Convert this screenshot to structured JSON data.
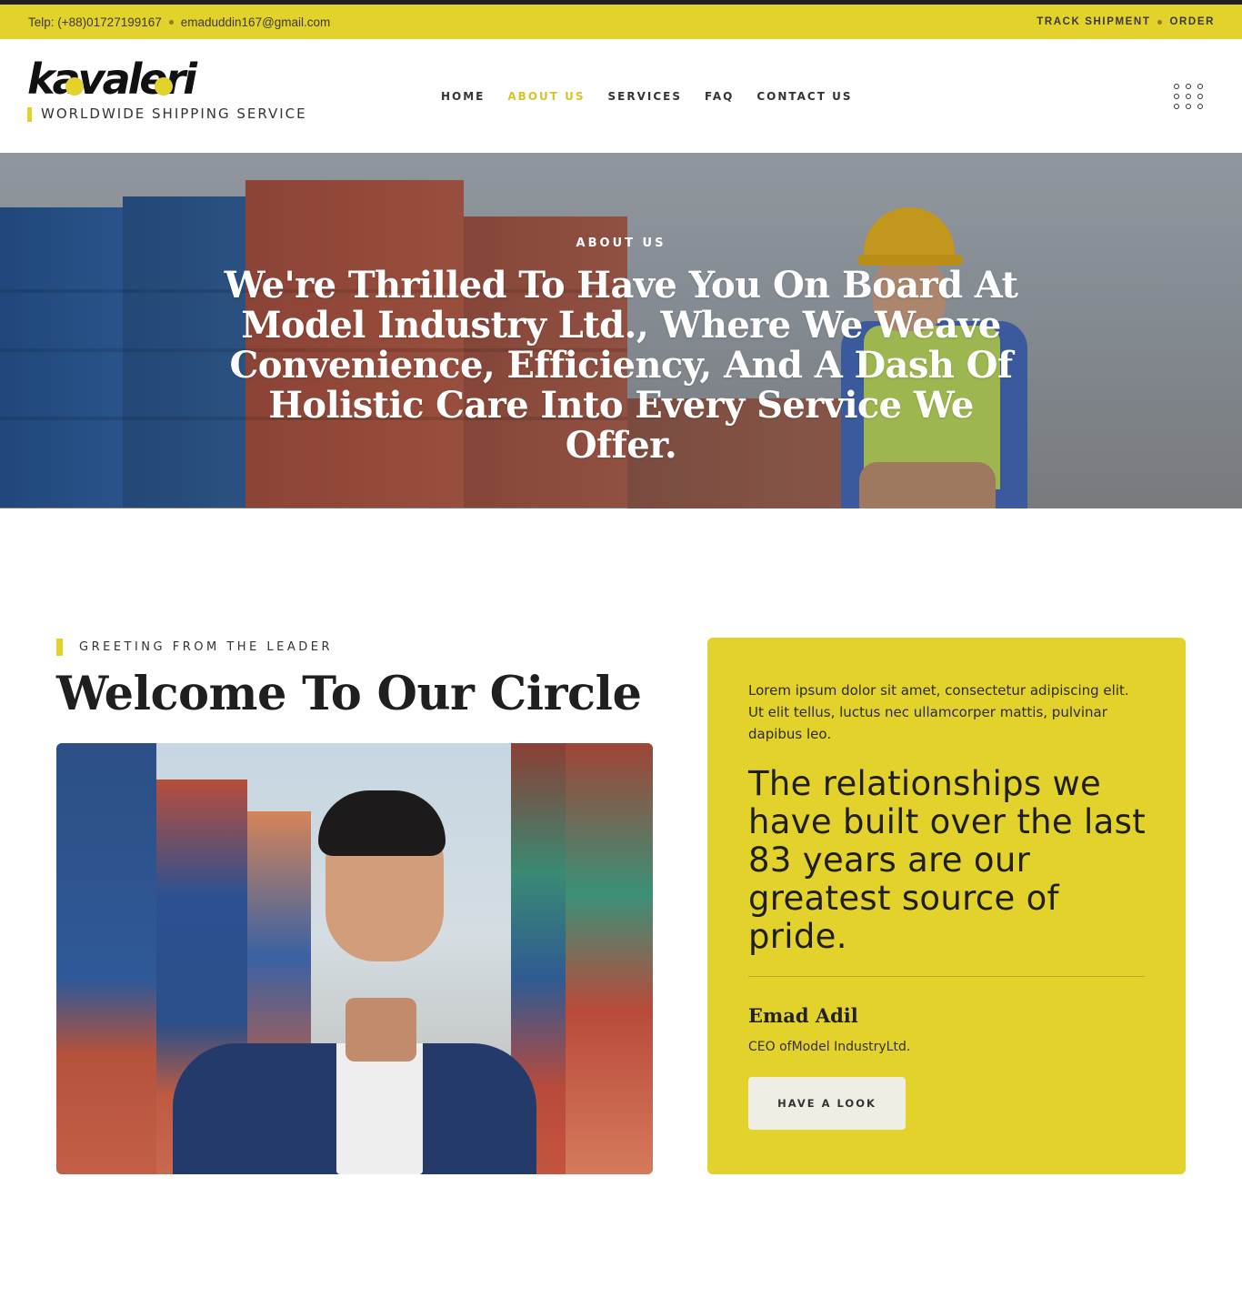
{
  "topbar": {
    "phone": "Telp: (+88)01727199167",
    "email": "emaduddin167@gmail.com",
    "track_shipment": "TRACK SHIPMENT",
    "order": "ORDER"
  },
  "header": {
    "logo_text": "kavaleri",
    "tagline": "WORLDWIDE SHIPPING SERVICE",
    "nav": [
      {
        "label": "HOME",
        "active": false
      },
      {
        "label": "ABOUT US",
        "active": true
      },
      {
        "label": "SERVICES",
        "active": false
      },
      {
        "label": "FAQ",
        "active": false
      },
      {
        "label": "CONTACT US",
        "active": false
      }
    ],
    "menu_icon": "grid-menu-icon"
  },
  "hero": {
    "subtitle": "ABOUT US",
    "title": "We're Thrilled To Have You On Board At Model Industry Ltd., Where We Weave Convenience, Efficiency, And A Dash Of Holistic Care Into Every Service We Offer."
  },
  "greeting": {
    "eyebrow": "GREETING FROM THE LEADER",
    "title": "Welcome To Our Circle"
  },
  "card": {
    "intro": "Lorem ipsum dolor sit amet, consectetur adipiscing elit. Ut elit tellus, luctus nec ullamcorper mattis, pulvinar dapibus leo.",
    "quote": "The relationships we have built over the last 83 years are our greatest source of pride.",
    "name": "Emad Adil",
    "role": "CEO ofModel IndustryLtd.",
    "button_label": "HAVE A LOOK"
  },
  "colors": {
    "accent": "#e3d12c",
    "dark": "#1f1f24",
    "text": "#222222"
  }
}
